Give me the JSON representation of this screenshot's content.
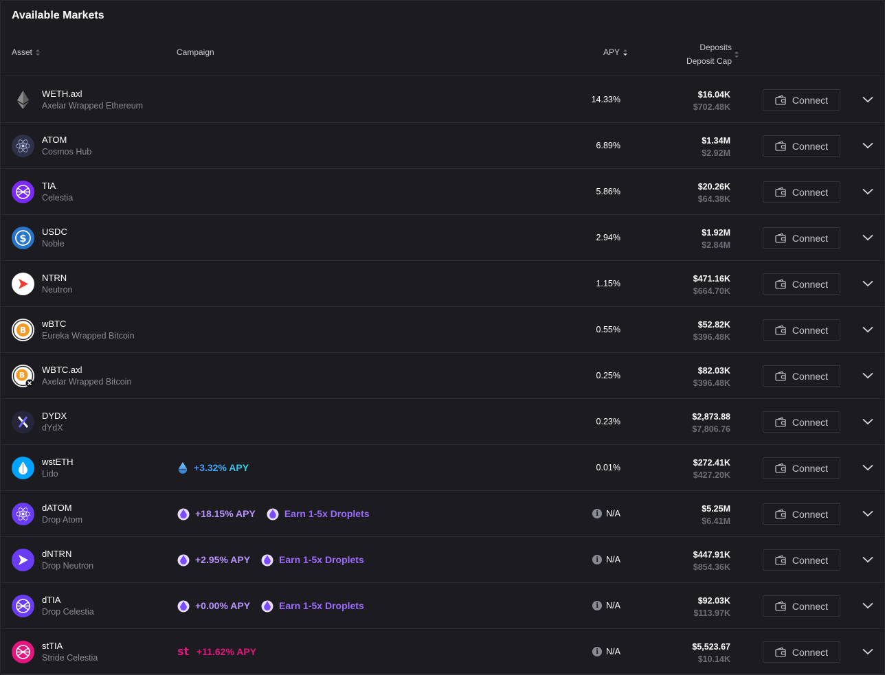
{
  "title": "Available Markets",
  "headers": {
    "asset": "Asset",
    "campaign": "Campaign",
    "apy": "APY",
    "deposits": "Deposits",
    "deposit_cap": "Deposit Cap"
  },
  "connect_label": "Connect",
  "markets": [
    {
      "symbol": "WETH.axl",
      "name": "Axelar Wrapped Ethereum",
      "apy": "14.33%",
      "deposits": "$16.04K",
      "cap": "$702.48K",
      "icon": "eth-icon",
      "campaign": []
    },
    {
      "symbol": "ATOM",
      "name": "Cosmos Hub",
      "apy": "6.89%",
      "deposits": "$1.34M",
      "cap": "$2.92M",
      "icon": "atom-icon",
      "campaign": []
    },
    {
      "symbol": "TIA",
      "name": "Celestia",
      "apy": "5.86%",
      "deposits": "$20.26K",
      "cap": "$64.38K",
      "icon": "tia-icon",
      "campaign": []
    },
    {
      "symbol": "USDC",
      "name": "Noble",
      "apy": "2.94%",
      "deposits": "$1.92M",
      "cap": "$2.84M",
      "icon": "usdc-icon",
      "campaign": []
    },
    {
      "symbol": "NTRN",
      "name": "Neutron",
      "apy": "1.15%",
      "deposits": "$471.16K",
      "cap": "$664.70K",
      "icon": "ntrn-icon",
      "campaign": []
    },
    {
      "symbol": "wBTC",
      "name": "Eureka Wrapped Bitcoin",
      "apy": "0.55%",
      "deposits": "$52.82K",
      "cap": "$396.48K",
      "icon": "btc-icon",
      "campaign": []
    },
    {
      "symbol": "WBTC.axl",
      "name": "Axelar Wrapped Bitcoin",
      "apy": "0.25%",
      "deposits": "$82.03K",
      "cap": "$396.48K",
      "icon": "btc-axl-icon",
      "campaign": []
    },
    {
      "symbol": "DYDX",
      "name": "dYdX",
      "apy": "0.23%",
      "deposits": "$2,873.88",
      "cap": "$7,806.76",
      "icon": "dydx-icon",
      "campaign": []
    },
    {
      "symbol": "wstETH",
      "name": "Lido",
      "apy": "0.01%",
      "deposits": "$272.41K",
      "cap": "$427.20K",
      "icon": "lido-icon",
      "campaign": [
        {
          "text": "+3.32% APY",
          "icon": "lido-drop-icon",
          "color": "gradient-lido"
        }
      ]
    },
    {
      "symbol": "dATOM",
      "name": "Drop Atom",
      "apy": "N/A",
      "apy_info": true,
      "deposits": "$5.25M",
      "cap": "$6.41M",
      "icon": "datom-icon",
      "campaign": [
        {
          "text": "+18.15% APY",
          "icon": "drop-icon",
          "color": "#b794ff"
        },
        {
          "text": "Earn 1-5x Droplets",
          "icon": "drop-icon",
          "color": "#9d6bff"
        }
      ]
    },
    {
      "symbol": "dNTRN",
      "name": "Drop Neutron",
      "apy": "N/A",
      "apy_info": true,
      "deposits": "$447.91K",
      "cap": "$854.36K",
      "icon": "dntrn-icon",
      "campaign": [
        {
          "text": "+2.95% APY",
          "icon": "drop-icon",
          "color": "#b794ff"
        },
        {
          "text": "Earn 1-5x Droplets",
          "icon": "drop-icon",
          "color": "#9d6bff"
        }
      ]
    },
    {
      "symbol": "dTIA",
      "name": "Drop Celestia",
      "apy": "N/A",
      "apy_info": true,
      "deposits": "$92.03K",
      "cap": "$113.97K",
      "icon": "dtia-icon",
      "campaign": [
        {
          "text": "+0.00% APY",
          "icon": "drop-icon",
          "color": "#b794ff"
        },
        {
          "text": "Earn 1-5x Droplets",
          "icon": "drop-icon",
          "color": "#9d6bff"
        }
      ]
    },
    {
      "symbol": "stTIA",
      "name": "Stride Celestia",
      "apy": "N/A",
      "apy_info": true,
      "deposits": "$5,523.67",
      "cap": "$10.14K",
      "icon": "sttia-icon",
      "campaign": [
        {
          "text": "+11.62% APY",
          "icon": "stride-icon",
          "color": "#e5157f"
        }
      ]
    }
  ]
}
